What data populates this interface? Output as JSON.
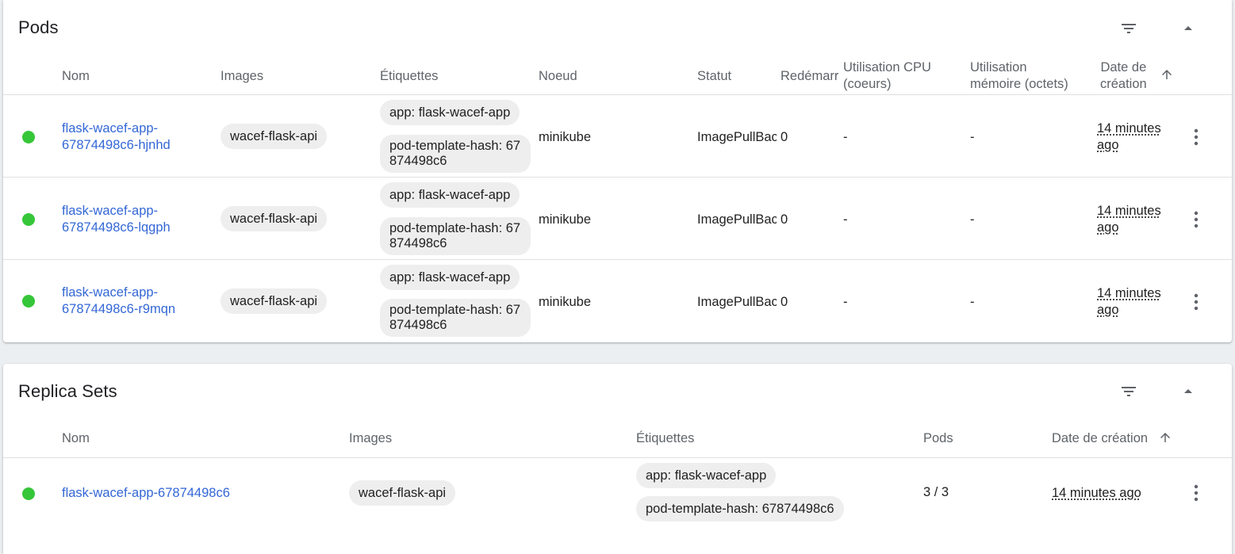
{
  "colors": {
    "status_ok": "#36c639",
    "link": "#3367d6"
  },
  "pods": {
    "title": "Pods",
    "filter_icon": "filter-list-icon",
    "collapse_icon": "arrow-drop-up-icon",
    "headers": {
      "name": "Nom",
      "images": "Images",
      "labels": "Étiquettes",
      "node": "Noeud",
      "status": "Statut",
      "restarts": "Redémarrages",
      "cpu_1": "Utilisation CPU",
      "cpu_2": "(coeurs)",
      "mem_1": "Utilisation",
      "mem_2": "mémoire (octets)",
      "created_1": "Date de",
      "created_2": "création"
    },
    "rows": [
      {
        "name_1": "flask-wacef-app-",
        "name_2": "67874498c6-hjnhd",
        "image": "wacef-flask-api",
        "label_app": "app: flask-wacef-app",
        "label_hash": "pod-template-hash: 67874498c6",
        "node": "minikube",
        "status": "ImagePullBackOff",
        "restarts": "0",
        "cpu": "-",
        "memory": "-",
        "created_1": "14 minutes",
        "created_2": "ago"
      },
      {
        "name_1": "flask-wacef-app-",
        "name_2": "67874498c6-lqgph",
        "image": "wacef-flask-api",
        "label_app": "app: flask-wacef-app",
        "label_hash": "pod-template-hash: 67874498c6",
        "node": "minikube",
        "status": "ImagePullBackOff",
        "restarts": "0",
        "cpu": "-",
        "memory": "-",
        "created_1": "14 minutes",
        "created_2": "ago"
      },
      {
        "name_1": "flask-wacef-app-",
        "name_2": "67874498c6-r9mqn",
        "image": "wacef-flask-api",
        "label_app": "app: flask-wacef-app",
        "label_hash": "pod-template-hash: 67874498c6",
        "node": "minikube",
        "status": "ImagePullBackOff",
        "restarts": "0",
        "cpu": "-",
        "memory": "-",
        "created_1": "14 minutes",
        "created_2": "ago"
      }
    ]
  },
  "replica_sets": {
    "title": "Replica Sets",
    "filter_icon": "filter-list-icon",
    "collapse_icon": "arrow-drop-up-icon",
    "headers": {
      "name": "Nom",
      "images": "Images",
      "labels": "Étiquettes",
      "pods": "Pods",
      "created": "Date de création"
    },
    "rows": [
      {
        "name": "flask-wacef-app-67874498c6",
        "image": "wacef-flask-api",
        "label_app": "app: flask-wacef-app",
        "label_hash": "pod-template-hash: 67874498c6",
        "pods": "3 / 3",
        "created": "14 minutes ago"
      }
    ]
  }
}
